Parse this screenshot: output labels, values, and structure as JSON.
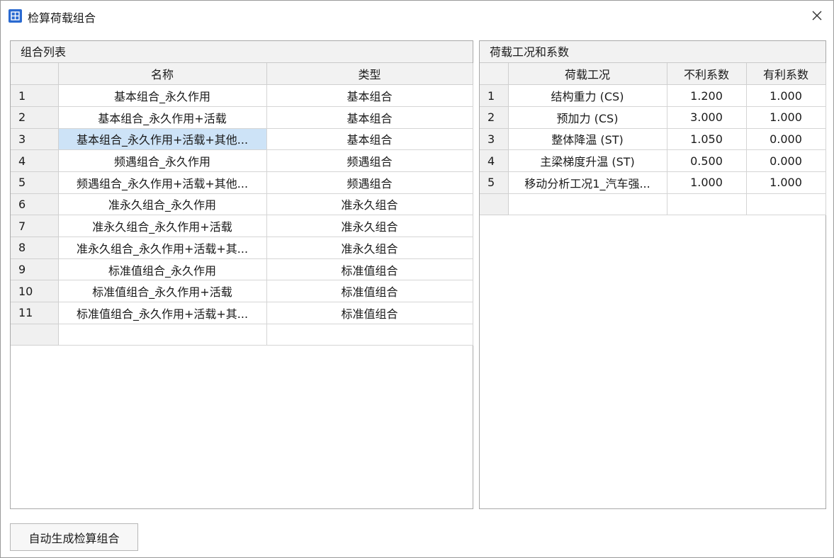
{
  "window": {
    "title": "检算荷载组合",
    "close_icon": "close-icon",
    "app_icon": "grid-app-icon",
    "app_icon_color": "#2a6ad1"
  },
  "left_panel": {
    "title": "组合列表",
    "columns": [
      "",
      "名称",
      "类型"
    ],
    "selected_row": 3,
    "selected_color": "#cde3f7",
    "rows": [
      {
        "num": "1",
        "name": "基本组合_永久作用",
        "type": "基本组合"
      },
      {
        "num": "2",
        "name": "基本组合_永久作用+活载",
        "type": "基本组合"
      },
      {
        "num": "3",
        "name": "基本组合_永久作用+活载+其他...",
        "type": "基本组合"
      },
      {
        "num": "4",
        "name": "频遇组合_永久作用",
        "type": "频遇组合"
      },
      {
        "num": "5",
        "name": "频遇组合_永久作用+活载+其他...",
        "type": "频遇组合"
      },
      {
        "num": "6",
        "name": "准永久组合_永久作用",
        "type": "准永久组合"
      },
      {
        "num": "7",
        "name": "准永久组合_永久作用+活载",
        "type": "准永久组合"
      },
      {
        "num": "8",
        "name": "准永久组合_永久作用+活载+其...",
        "type": "准永久组合"
      },
      {
        "num": "9",
        "name": "标准值组合_永久作用",
        "type": "标准值组合"
      },
      {
        "num": "10",
        "name": "标准值组合_永久作用+活载",
        "type": "标准值组合"
      },
      {
        "num": "11",
        "name": "标准值组合_永久作用+活载+其...",
        "type": "标准值组合"
      },
      {
        "num": "",
        "name": "",
        "type": ""
      }
    ]
  },
  "right_panel": {
    "title": "荷载工况和系数",
    "columns": [
      "",
      "荷载工况",
      "不利系数",
      "有利系数"
    ],
    "rows": [
      {
        "num": "1",
        "case": "结构重力 (CS)",
        "unfav": "1.200",
        "fav": "1.000"
      },
      {
        "num": "2",
        "case": "预加力 (CS)",
        "unfav": "3.000",
        "fav": "1.000"
      },
      {
        "num": "3",
        "case": "整体降温 (ST)",
        "unfav": "1.050",
        "fav": "0.000"
      },
      {
        "num": "4",
        "case": "主梁梯度升温 (ST)",
        "unfav": "0.500",
        "fav": "0.000"
      },
      {
        "num": "5",
        "case": "移动分析工况1_汽车强...",
        "unfav": "1.000",
        "fav": "1.000"
      },
      {
        "num": "",
        "case": "",
        "unfav": "",
        "fav": ""
      }
    ]
  },
  "footer": {
    "auto_generate_label": "自动生成检算组合"
  }
}
